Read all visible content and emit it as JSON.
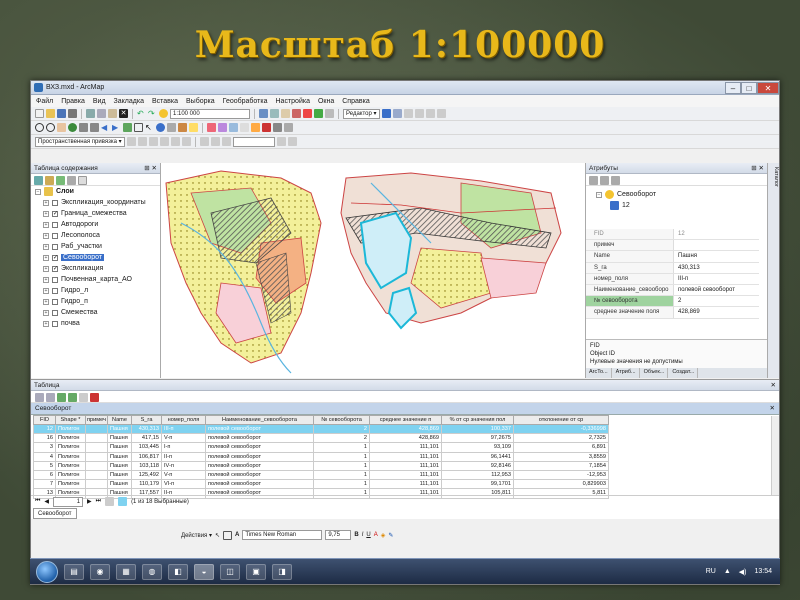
{
  "slide": {
    "title": "Масштаб 1:100000"
  },
  "window": {
    "title": "ВХЗ.mxd - ArcMap"
  },
  "menu": [
    "Файл",
    "Правка",
    "Вид",
    "Закладка",
    "Вставка",
    "Выборка",
    "Геообработка",
    "Настройка",
    "Окна",
    "Справка"
  ],
  "toolbar": {
    "scale": "1:100 000",
    "editor": "Редактор ▾",
    "snapping": "Пространственная привязка ▾"
  },
  "toc": {
    "title": "Таблица содержания",
    "root": "Слои",
    "layers": [
      {
        "name": "Экспликация_координаты",
        "checked": false
      },
      {
        "name": "Граница_смежества",
        "checked": true
      },
      {
        "name": "Автодороги",
        "checked": false
      },
      {
        "name": "Лесополоса",
        "checked": false
      },
      {
        "name": "Раб_участки",
        "checked": false
      },
      {
        "name": "Севооборот",
        "checked": true,
        "selected": true
      },
      {
        "name": "Экспликация",
        "checked": true
      },
      {
        "name": "Почвенная_карта_АО",
        "checked": false
      },
      {
        "name": "Гидро_л",
        "checked": false
      },
      {
        "name": "Гидро_п",
        "checked": false
      },
      {
        "name": "Смежества",
        "checked": false
      },
      {
        "name": "почва",
        "checked": false
      }
    ]
  },
  "attributes": {
    "title": "Атрибуты",
    "layer": "Севооборот",
    "feature": "12",
    "rows": [
      {
        "field": "FID",
        "value": "12",
        "dim": true
      },
      {
        "field": "примеч",
        "value": ""
      },
      {
        "field": "Name",
        "value": "Пашня"
      },
      {
        "field": "S_га",
        "value": "430,313"
      },
      {
        "field": "номер_поля",
        "value": "III-п"
      },
      {
        "field": "Наименование_севооборо",
        "value": "полевой севооборот"
      },
      {
        "field": "№ севооборота",
        "value": "2",
        "highlight": true
      },
      {
        "field": "среднее значение поля",
        "value": "428,869"
      }
    ],
    "help_title": "FID",
    "help_line1": "Object ID",
    "help_line2": "Нулевые значения не допустимы",
    "tabs": [
      "ArcTo...",
      "Атриб...",
      "Объек...",
      "Создат..."
    ],
    "side": "Каталог"
  },
  "table": {
    "title": "Таблица",
    "name": "Севооборот",
    "columns": [
      "FID",
      "Shape *",
      "примеч",
      "Name",
      "S_га",
      "номер_поля",
      "Наименование_севооборота",
      "№ севооборота",
      "среднее значение п",
      "% от ср значения пол",
      "отклонение от ср"
    ],
    "rows": [
      [
        "12",
        "Полигон",
        "",
        "Пашня",
        "430,313",
        "III-п",
        "полевой севооборот",
        "2",
        "428,869",
        "100,337",
        "-0,336998"
      ],
      [
        "16",
        "Полигон",
        "",
        "Пашня",
        "417,15",
        "V-п",
        "полевой севооборот",
        "2",
        "428,869",
        "97,2675",
        "2,7325"
      ],
      [
        "3",
        "Полигон",
        "",
        "Пашня",
        "103,445",
        "I-п",
        "полевой севооборот",
        "1",
        "111,101",
        "93,109",
        "6,891"
      ],
      [
        "4",
        "Полигон",
        "",
        "Пашня",
        "106,817",
        "II-п",
        "полевой севооборот",
        "1",
        "111,101",
        "96,1441",
        "3,8559"
      ],
      [
        "5",
        "Полигон",
        "",
        "Пашня",
        "103,118",
        "IV-п",
        "полевой севооборот",
        "1",
        "111,101",
        "92,8146",
        "7,1854"
      ],
      [
        "6",
        "Полигон",
        "",
        "Пашня",
        "125,492",
        "V-п",
        "полевой севооборот",
        "1",
        "111,101",
        "112,953",
        "-12,953"
      ],
      [
        "7",
        "Полигон",
        "",
        "Пашня",
        "110,179",
        "VI-п",
        "полевой севооборот",
        "1",
        "111,101",
        "99,1701",
        "0,829903"
      ],
      [
        "13",
        "Полигон",
        "",
        "Пашня",
        "117,557",
        "II-п",
        "полевой севооборот",
        "1",
        "111,101",
        "105,811",
        "5,811"
      ]
    ],
    "record": "1",
    "selection": "(1 из 18 Выбранные)",
    "tab_name": "Севооборот"
  },
  "drawbar": {
    "actions": "Действия ▾",
    "font": "Times New Roman",
    "size": "9,75"
  },
  "taskbar": {
    "lang": "RU",
    "time": "13:54"
  }
}
